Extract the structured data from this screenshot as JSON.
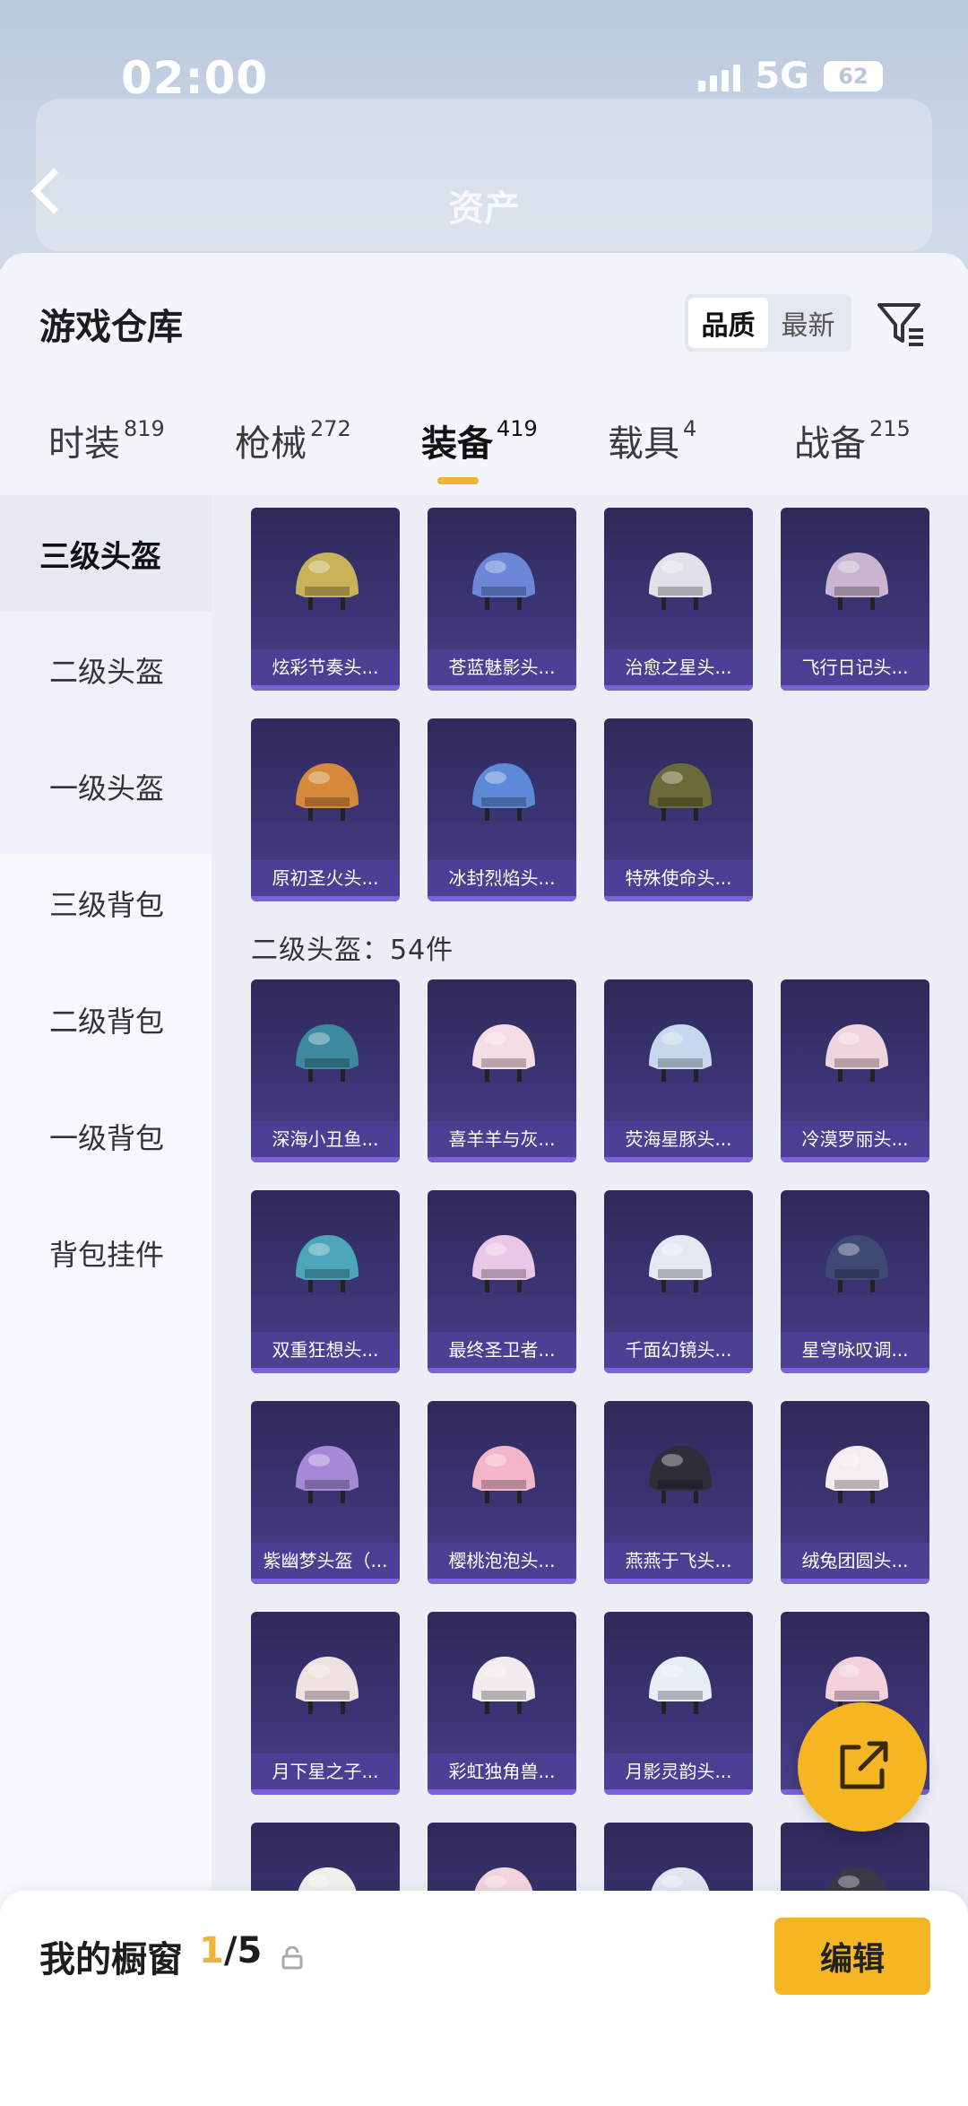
{
  "status_bar": {
    "time": "02:00",
    "network": "5G",
    "battery": "62"
  },
  "header": {
    "title": "资产"
  },
  "page": {
    "title": "游戏仓库",
    "sort_options": [
      "品质",
      "最新"
    ],
    "active_sort": "品质"
  },
  "tabs": [
    {
      "label": "时装",
      "count": "819"
    },
    {
      "label": "枪械",
      "count": "272"
    },
    {
      "label": "装备",
      "count": "419"
    },
    {
      "label": "载具",
      "count": "4"
    },
    {
      "label": "战备",
      "count": "215"
    }
  ],
  "active_tab": "装备",
  "sidebar": {
    "items": [
      "三级头盔",
      "二级头盔",
      "一级头盔",
      "三级背包",
      "二级背包",
      "一级背包",
      "背包挂件"
    ],
    "active": "三级头盔"
  },
  "sections": [
    {
      "label": "",
      "items": [
        {
          "name": "炫彩节奏头...",
          "color": "#c9b25a"
        },
        {
          "name": "苍蓝魅影头...",
          "color": "#6c86d8"
        },
        {
          "name": "治愈之星头...",
          "color": "#e0e2ea"
        },
        {
          "name": "飞行日记头...",
          "color": "#c9b5cf"
        },
        {
          "name": "原初圣火头...",
          "color": "#d48a3a"
        },
        {
          "name": "冰封烈焰头...",
          "color": "#5c8ad6"
        },
        {
          "name": "特殊使命头...",
          "color": "#6b6b3a"
        }
      ]
    },
    {
      "label": "二级头盔：54件",
      "items": [
        {
          "name": "深海小丑鱼...",
          "color": "#3d8aa0"
        },
        {
          "name": "喜羊羊与灰...",
          "color": "#f4dde4"
        },
        {
          "name": "荧海星豚头...",
          "color": "#c7d8ee"
        },
        {
          "name": "冷漠罗丽头...",
          "color": "#f0d4de"
        },
        {
          "name": "双重狂想头...",
          "color": "#4aa6b8"
        },
        {
          "name": "最终圣卫者...",
          "color": "#e8c8e6"
        },
        {
          "name": "千面幻镜头...",
          "color": "#e4e8f2"
        },
        {
          "name": "星穹咏叹调...",
          "color": "#3e4a74"
        },
        {
          "name": "紫幽梦头盔（...",
          "color": "#a68ad8"
        },
        {
          "name": "樱桃泡泡头...",
          "color": "#f2b6c8"
        },
        {
          "name": "燕燕于飞头...",
          "color": "#2e2e3a"
        },
        {
          "name": "绒兔团圆头...",
          "color": "#f4eef0"
        },
        {
          "name": "月下星之子...",
          "color": "#efe2e0"
        },
        {
          "name": "彩虹独角兽...",
          "color": "#f2ecee"
        },
        {
          "name": "月影灵韵头...",
          "color": "#e8eef6"
        },
        {
          "name": "",
          "color": "#f2d0dc"
        },
        {
          "name": "",
          "color": "#eef0ee"
        },
        {
          "name": "",
          "color": "#f2d4de"
        },
        {
          "name": "",
          "color": "#dfe6f2"
        },
        {
          "name": "",
          "color": "#3a3a46"
        }
      ]
    }
  ],
  "showcase": {
    "label": "我的橱窗",
    "current": "1",
    "total": "/5",
    "edit_label": "编辑"
  },
  "accent_color": "#f5b623"
}
